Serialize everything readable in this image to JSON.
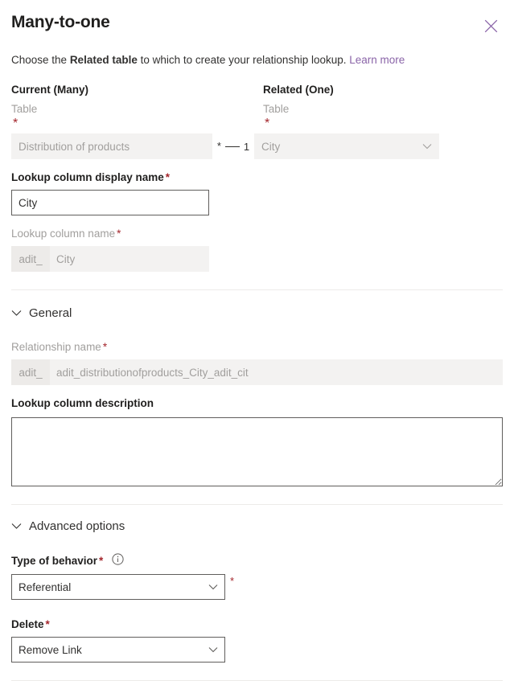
{
  "panel": {
    "title": "Many-to-one",
    "close_icon": "close-icon",
    "description": {
      "prefix": "Choose the ",
      "bold": "Related table",
      "suffix": " to which to create your relationship lookup. ",
      "link": "Learn more"
    }
  },
  "current_section": {
    "heading": "Current (Many)",
    "table_label": "Table",
    "table_required": "*",
    "table_value": "Distribution of products"
  },
  "related_section": {
    "heading": "Related (One)",
    "table_label": "Table",
    "table_required": "*",
    "table_value": "City",
    "chevron_icon": "chevron-down-icon"
  },
  "relationship_indicator": {
    "many": "*",
    "one": "1"
  },
  "lookup_display_name": {
    "label": "Lookup column display name",
    "required": "*",
    "value": "City"
  },
  "lookup_column_name": {
    "label": "Lookup column name",
    "required": "*",
    "prefix": "adit_",
    "value": "City"
  },
  "general": {
    "section_label": "General",
    "chevron_icon": "chevron-down-icon",
    "relationship_name": {
      "label": "Relationship name",
      "required": "*",
      "prefix": "adit_",
      "value": "adit_distributionofproducts_City_adit_cit"
    },
    "lookup_description": {
      "label": "Lookup column description",
      "value": "",
      "placeholder": ""
    }
  },
  "advanced": {
    "section_label": "Advanced options",
    "chevron_icon": "chevron-down-icon",
    "type_of_behavior": {
      "label": "Type of behavior",
      "required": "*",
      "info_icon": "info-icon",
      "value": "Referential",
      "side_required": "*",
      "chevron_icon": "chevron-down-icon"
    },
    "delete": {
      "label": "Delete",
      "required": "*",
      "value": "Remove Link",
      "chevron_icon": "chevron-down-icon"
    }
  },
  "colors": {
    "link": "#8a64a8",
    "required": "#a4262c",
    "border": "#605e5c",
    "disabled_bg": "#f3f2f1",
    "divider": "#edebe9",
    "text": "#323130"
  }
}
